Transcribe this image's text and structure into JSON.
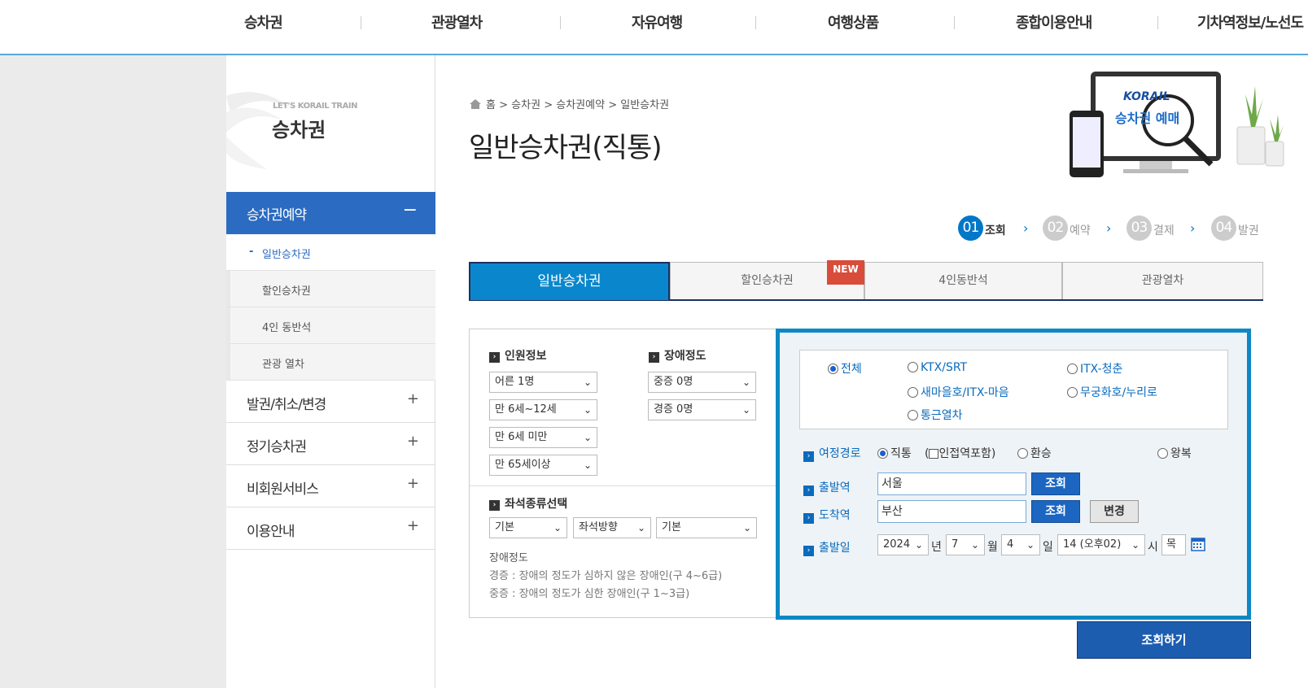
{
  "topnav": {
    "items": [
      "승차권",
      "관광열차",
      "자유여행",
      "여행상품",
      "종합이용안내",
      "기차역정보/노선도"
    ]
  },
  "sidebar": {
    "subtitle": "LET'S KORAIL TRAIN",
    "title": "승차권",
    "active": {
      "label": "승차권예약",
      "sign": "−"
    },
    "subitems": [
      "일반승차권",
      "할인승차권",
      "4인 동반석",
      "관광 열차"
    ],
    "current_marker": "-",
    "items": [
      {
        "label": "발권/취소/변경",
        "sign": "+"
      },
      {
        "label": "정기승차권",
        "sign": "+"
      },
      {
        "label": "비회원서비스",
        "sign": "+"
      },
      {
        "label": "이용안내",
        "sign": "+"
      }
    ]
  },
  "breadcrumb": {
    "home": "홈",
    "b1": "승차권",
    "b2": "승차권예약",
    "b3": "일반승차권",
    "sep": ">"
  },
  "page_title": "일반승차권(직통)",
  "illustration": {
    "brand": "KORAIL",
    "text": "승차권 예매"
  },
  "steps": [
    {
      "num": "01",
      "label": "조회"
    },
    {
      "num": "02",
      "label": "예약"
    },
    {
      "num": "03",
      "label": "결제"
    },
    {
      "num": "04",
      "label": "발권"
    }
  ],
  "step_arrow": "›",
  "tabs": [
    "일반승차권",
    "할인승차권",
    "4인동반석",
    "관광열차"
  ],
  "new_badge": "NEW",
  "passenger": {
    "heading": "인원정보",
    "adult": "어른 1명",
    "child": "만 6세~12세",
    "toddler": "만 6세 미만",
    "senior": "만 65세이상"
  },
  "disability": {
    "heading": "장애정도",
    "severe": "중증 0명",
    "mild": "경증 0명"
  },
  "seat": {
    "heading": "좌석종류선택",
    "type": "기본",
    "direction": "좌석방향",
    "extra": "기본"
  },
  "notes": {
    "title": "장애정도",
    "mild": "경증 : 장애의 정도가 심하지 않은 장애인(구 4~6급)",
    "severe": "중증 : 장애의 정도가 심한 장애인(구 1~3급)"
  },
  "train_types": [
    "전체",
    "KTX/SRT",
    "ITX-청춘",
    "새마을호/ITX-마음",
    "무궁화호/누리로",
    "통근열차"
  ],
  "route": {
    "label": "여정경로",
    "direct": "직통",
    "nearby": "(",
    "nearby_label": "인접역포함)",
    "transfer": "환승",
    "round": "왕복"
  },
  "departure": {
    "label": "출발역",
    "value": "서울",
    "btn": "조회"
  },
  "arrival": {
    "label": "도착역",
    "value": "부산",
    "btn": "조회",
    "swap": "변경"
  },
  "date": {
    "label": "출발일",
    "year": "2024",
    "year_unit": "년",
    "month": "7",
    "month_unit": "월",
    "day": "4",
    "day_unit": "일",
    "hour": "14 (오후02)",
    "hour_unit": "시",
    "weekday": "목"
  },
  "search_button": "조회하기",
  "colors": {
    "accent": "#0a87cc",
    "nav_active": "#2b6bc1",
    "frame": "#0e88c4",
    "badge": "#d94c3a"
  },
  "icons": {
    "bullet": "›",
    "chev": "⌄"
  }
}
